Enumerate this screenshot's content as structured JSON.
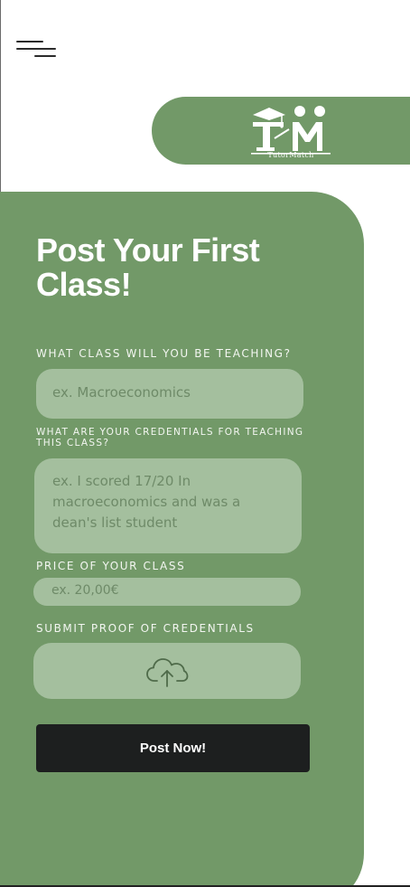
{
  "logo": {
    "name": "TutorMatch",
    "icon": "graduation-cap-teacher-student-logo"
  },
  "nav": {
    "menu_icon": "hamburger-menu-icon"
  },
  "form": {
    "title": "Post Your First Class!",
    "class_label": "WHAT CLASS WILL YOU BE TEACHING?",
    "class_placeholder": "ex. Macroeconomics",
    "credentials_label": "WHAT ARE YOUR CREDENTIALS FOR TEACHING THIS CLASS?",
    "credentials_placeholder": "ex. I scored 17/20 In macroeconomics and was a dean's list student",
    "price_label": "PRICE OF YOUR CLASS",
    "price_placeholder": "ex. 20,00€",
    "proof_label": "SUBMIT PROOF OF CREDENTIALS",
    "upload_icon": "cloud-upload-icon",
    "submit_label": "Post Now!"
  },
  "colors": {
    "brand_green": "#729968",
    "field_green": "#a4bf9e",
    "button_dark": "#1d1f1f"
  }
}
